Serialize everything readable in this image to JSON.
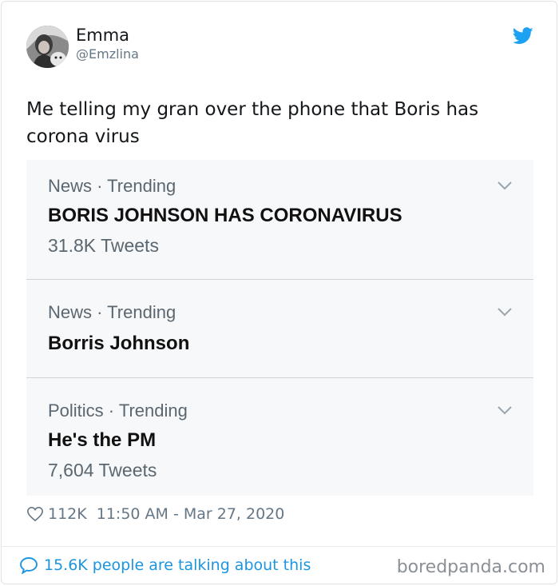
{
  "tweet": {
    "author_name": "Emma",
    "author_handle": "@Emzlina",
    "text": "Me telling my gran over the phone that Boris has corona virus",
    "likes": "112K",
    "timestamp": "11:50 AM - Mar 27, 2020",
    "conversation_text": "15.6K people are talking about this"
  },
  "trends": [
    {
      "meta": "News · Trending",
      "title": "BORIS JOHNSON HAS CORONAVIRUS",
      "count": "31.8K Tweets"
    },
    {
      "meta": "News · Trending",
      "title": "Borris Johnson",
      "count": ""
    },
    {
      "meta": "Politics · Trending",
      "title": "He's the PM",
      "count": "7,604 Tweets"
    }
  ],
  "watermark": "boredpanda.com",
  "colors": {
    "twitter_blue": "#1da1f2",
    "link_blue": "#1b95e0",
    "gray_text": "#657786"
  },
  "icons": [
    "twitter-bird-icon",
    "chevron-down-icon",
    "heart-icon",
    "speech-bubble-icon"
  ]
}
